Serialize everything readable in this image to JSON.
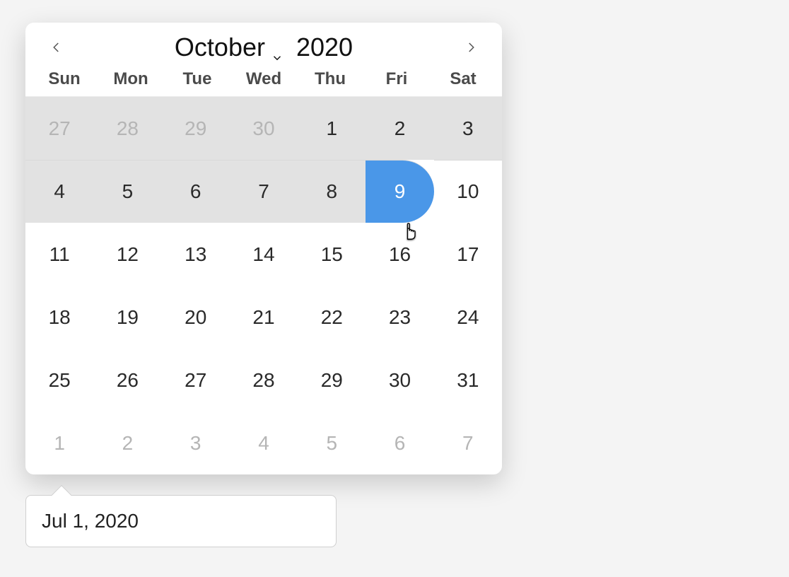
{
  "calendar": {
    "month_label": "October",
    "year_label": "2020",
    "weekdays": [
      "Sun",
      "Mon",
      "Tue",
      "Wed",
      "Thu",
      "Fri",
      "Sat"
    ],
    "weeks": [
      {
        "highlight": true,
        "days": [
          {
            "n": "27",
            "out": true
          },
          {
            "n": "28",
            "out": true
          },
          {
            "n": "29",
            "out": true
          },
          {
            "n": "30",
            "out": true
          },
          {
            "n": "1"
          },
          {
            "n": "2"
          },
          {
            "n": "3"
          }
        ]
      },
      {
        "highlight": true,
        "days": [
          {
            "n": "4"
          },
          {
            "n": "5"
          },
          {
            "n": "6"
          },
          {
            "n": "7"
          },
          {
            "n": "8"
          },
          {
            "n": "9",
            "range_end": true
          },
          {
            "n": "10"
          }
        ]
      },
      {
        "highlight": false,
        "days": [
          {
            "n": "11"
          },
          {
            "n": "12"
          },
          {
            "n": "13"
          },
          {
            "n": "14"
          },
          {
            "n": "15"
          },
          {
            "n": "16"
          },
          {
            "n": "17"
          }
        ]
      },
      {
        "highlight": false,
        "days": [
          {
            "n": "18"
          },
          {
            "n": "19"
          },
          {
            "n": "20"
          },
          {
            "n": "21"
          },
          {
            "n": "22"
          },
          {
            "n": "23"
          },
          {
            "n": "24"
          }
        ]
      },
      {
        "highlight": false,
        "days": [
          {
            "n": "25"
          },
          {
            "n": "26"
          },
          {
            "n": "27"
          },
          {
            "n": "28"
          },
          {
            "n": "29"
          },
          {
            "n": "30"
          },
          {
            "n": "31"
          }
        ]
      },
      {
        "highlight": false,
        "days": [
          {
            "n": "1",
            "out": true
          },
          {
            "n": "2",
            "out": true
          },
          {
            "n": "3",
            "out": true
          },
          {
            "n": "4",
            "out": true
          },
          {
            "n": "5",
            "out": true
          },
          {
            "n": "6",
            "out": true
          },
          {
            "n": "7",
            "out": true
          }
        ]
      }
    ]
  },
  "date_input": {
    "value": "Jul 1, 2020"
  },
  "colors": {
    "accent": "#4a97e8"
  }
}
